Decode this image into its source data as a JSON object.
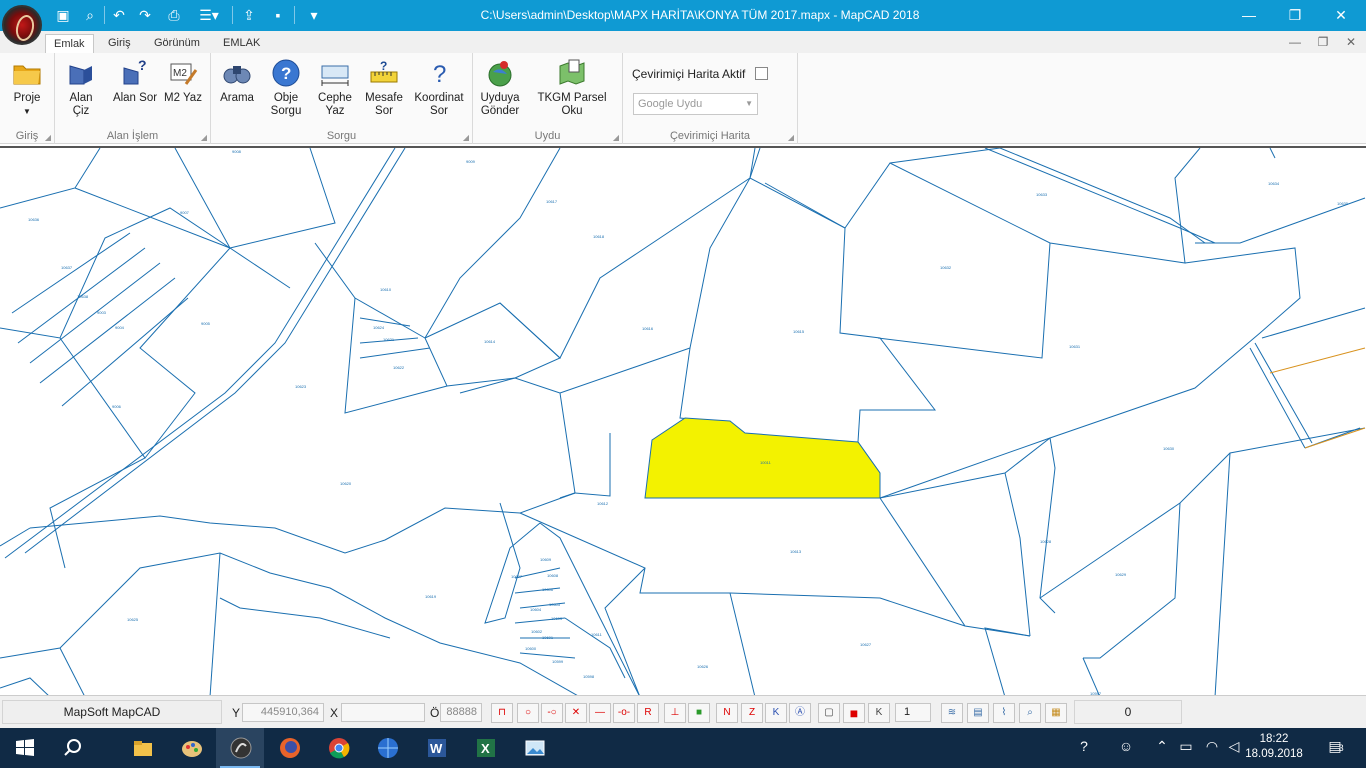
{
  "window": {
    "title": "C:\\Users\\admin\\Desktop\\MAPX HARİTA\\KONYA TÜM 2017.mapx - MapCAD 2018",
    "minimize": "—",
    "restore": "❐",
    "close": "✕"
  },
  "quick_access": [
    "new-file-icon",
    "search-file-icon",
    "undo-icon",
    "redo-icon",
    "print-icon",
    "list-icon",
    "export-icon",
    "save-icon",
    "customize-icon"
  ],
  "tabs": [
    {
      "label": "Emlak",
      "active": true
    },
    {
      "label": "Giriş",
      "active": false
    },
    {
      "label": "Görünüm",
      "active": false
    },
    {
      "label": "EMLAK",
      "active": false
    }
  ],
  "mdi": {
    "minimize": "—",
    "restore": "❐",
    "close": "✕"
  },
  "ribbon": {
    "groups": [
      {
        "label": "Giriş",
        "buttons": [
          {
            "label": "Proje",
            "icon": "folder-icon"
          }
        ]
      },
      {
        "label": "Alan İşlem",
        "buttons": [
          {
            "label": "Alan Çiz",
            "icon": "draw-area-icon"
          },
          {
            "label": "Alan Sor",
            "icon": "query-area-icon"
          },
          {
            "label": "M2 Yaz",
            "icon": "m2-write-icon"
          }
        ]
      },
      {
        "label": "Sorgu",
        "buttons": [
          {
            "label": "Arama",
            "icon": "binoculars-icon"
          },
          {
            "label": "Obje Sorgu",
            "icon": "help-circle-icon"
          },
          {
            "label": "Cephe Yaz",
            "icon": "ruler-width-icon"
          },
          {
            "label": "Mesafe Sor",
            "icon": "ruler-question-icon"
          },
          {
            "label": "Koordinat Sor",
            "icon": "question-mark-icon"
          }
        ]
      },
      {
        "label": "Uydu",
        "buttons": [
          {
            "label": "Uyduya Gönder",
            "icon": "globe-pin-icon"
          },
          {
            "label": "TKGM Parsel Oku",
            "icon": "map-read-icon"
          }
        ]
      },
      {
        "label": "Çevirimiçi Harita",
        "buttons": []
      }
    ],
    "online_map": {
      "checkbox_label": "Çevirimiçi Harita Aktif",
      "checked": false,
      "combo_value": "Google Uydu"
    }
  },
  "map": {
    "parcel_stroke": "#1a6fb0",
    "highlight_fill": "#f3f200",
    "parcel_labels": [
      "10011",
      "10613",
      "10617",
      "10618",
      "10616",
      "10615",
      "10614",
      "10610",
      "10624",
      "10621",
      "10622",
      "10623",
      "10620",
      "10619",
      "10625",
      "10626",
      "10627",
      "10628",
      "10629",
      "10630",
      "10631",
      "10632",
      "10633",
      "10634",
      "10635",
      "10636",
      "10637",
      "10638",
      "9003",
      "9004",
      "9005",
      "9006",
      "9007",
      "9008",
      "9009",
      "10612",
      "10611",
      "10609",
      "10608",
      "10607",
      "10606",
      "10605",
      "10604",
      "10603",
      "10602",
      "10601",
      "10600",
      "10599",
      "10598",
      "10597"
    ]
  },
  "statusbar": {
    "app_label": "MapSoft MapCAD",
    "y_label": "Y",
    "y_value": "445910,364",
    "x_label": "X",
    "x_value": "",
    "o_label": "Ö",
    "o_value": "88888",
    "tools_red": [
      "magnet-icon",
      "point-snap-icon",
      "line-snap-icon",
      "intersection-snap-icon",
      "horizontal-snap-icon",
      "midpoint-snap-icon",
      "r-snap-icon"
    ],
    "tools_mid": [
      "perpendicular-icon",
      "layer-green-icon",
      "north-icon",
      "z-icon",
      "k-icon",
      "a-icon",
      "select-box-icon",
      "red-fill-icon",
      "k-box-icon"
    ],
    "spin_value": "1",
    "tools_right": [
      "layers-icon",
      "image-icon",
      "chart-icon",
      "zoom-extent-icon",
      "folder-db-icon"
    ],
    "counter": "0"
  },
  "taskbar": {
    "apps": [
      "windows-start-icon",
      "search-icon",
      "file-explorer-icon",
      "paint-icon",
      "mapcad-icon",
      "firefox-icon",
      "chrome-icon",
      "globe-app-icon",
      "word-icon",
      "excel-icon",
      "photos-icon"
    ],
    "tray": [
      "help-icon",
      "people-icon",
      "chevron-up-icon",
      "battery-icon",
      "wifi-icon",
      "volume-icon"
    ],
    "time": "18:22",
    "date": "18.09.2018",
    "notifications": "3"
  }
}
